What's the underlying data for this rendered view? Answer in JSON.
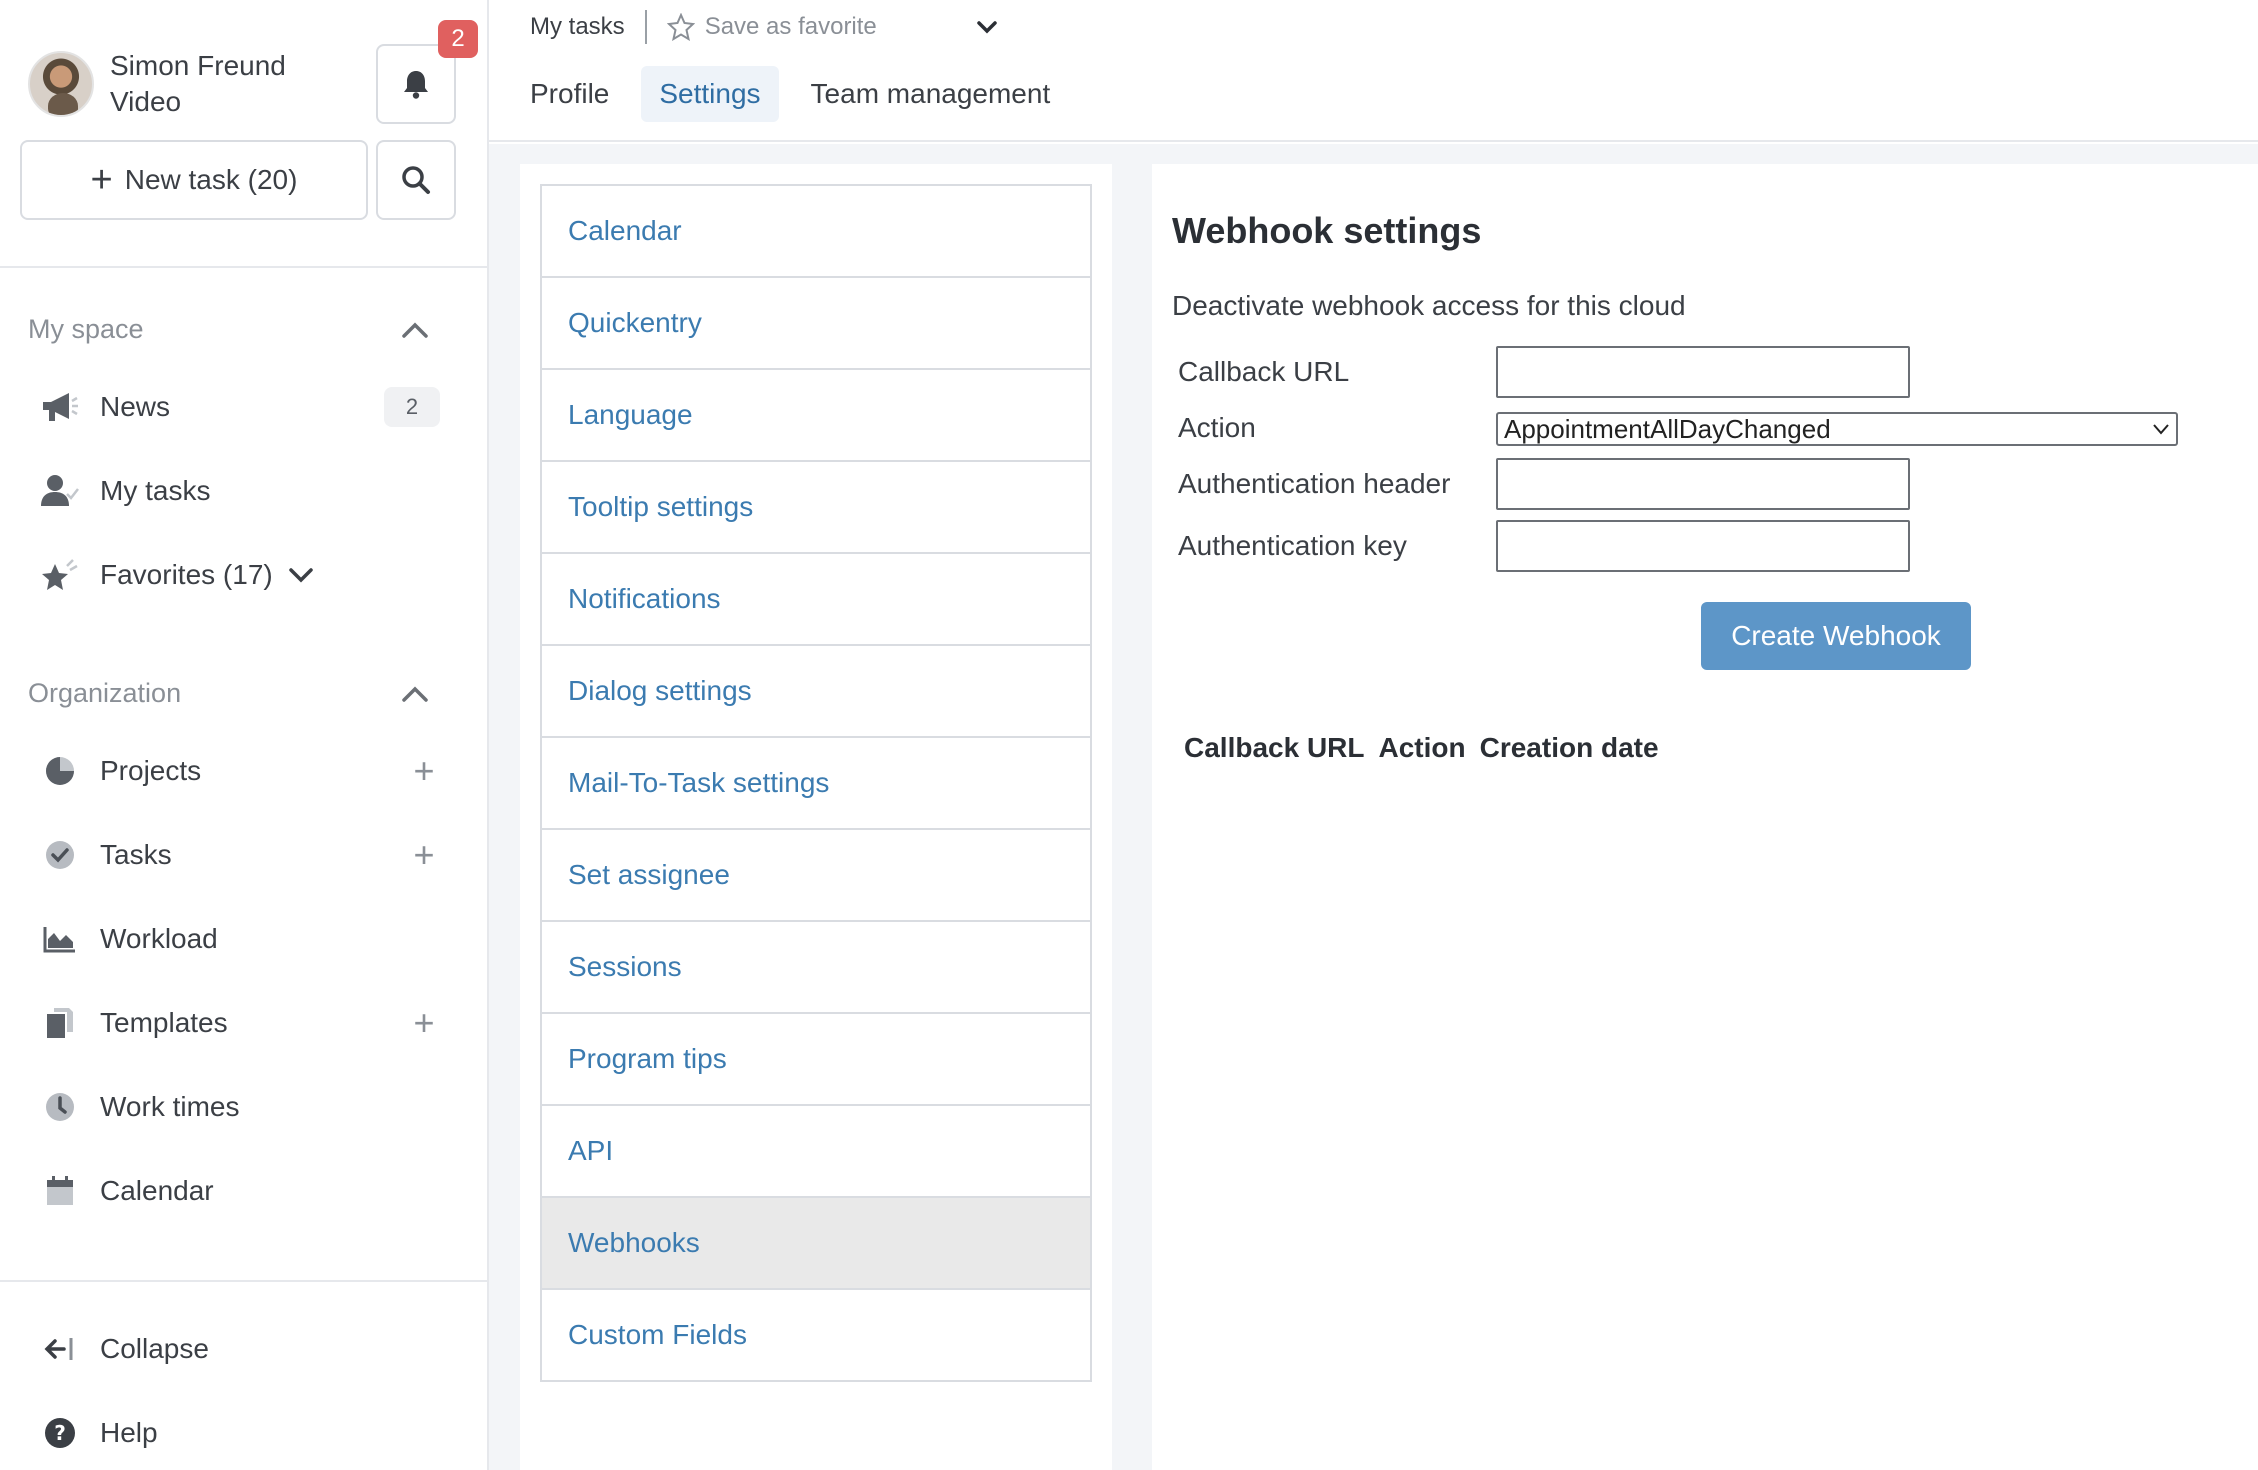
{
  "user": {
    "name": "Simon Freund",
    "subtitle": "Video"
  },
  "notifications": {
    "count": "2"
  },
  "new_task": {
    "label": "New task (20)"
  },
  "my_space": {
    "title": "My space",
    "items": [
      {
        "label": "News",
        "count": "2",
        "icon": "megaphone-icon"
      },
      {
        "label": "My tasks",
        "icon": "user-check-icon"
      },
      {
        "label": "Favorites (17)",
        "icon": "star-icon"
      }
    ]
  },
  "organization": {
    "title": "Organization",
    "items": [
      {
        "label": "Projects",
        "icon": "pie-icon",
        "add": "+"
      },
      {
        "label": "Tasks",
        "icon": "check-circle-icon",
        "add": "+"
      },
      {
        "label": "Workload",
        "icon": "area-chart-icon"
      },
      {
        "label": "Templates",
        "icon": "documents-icon",
        "add": "+"
      },
      {
        "label": "Work times",
        "icon": "clock-icon"
      },
      {
        "label": "Calendar",
        "icon": "calendar-icon"
      }
    ]
  },
  "footer": {
    "collapse": "Collapse",
    "help": "Help"
  },
  "breadcrumb": {
    "current": "My tasks",
    "favorite": "Save as favorite"
  },
  "tabs": [
    {
      "label": "Profile"
    },
    {
      "label": "Settings",
      "active": true
    },
    {
      "label": "Team management"
    }
  ],
  "settings_menu": [
    "Calendar",
    "Quickentry",
    "Language",
    "Tooltip settings",
    "Notifications",
    "Dialog settings",
    "Mail-To-Task settings",
    "Set assignee",
    "Sessions",
    "Program tips",
    "API",
    "Webhooks",
    "Custom Fields"
  ],
  "webhook": {
    "title": "Webhook settings",
    "description": "Deactivate webhook access for this cloud",
    "callback_label": "Callback URL",
    "callback_value": "",
    "action_label": "Action",
    "action_value": "AppointmentAllDayChanged",
    "auth_header_label": "Authentication header",
    "auth_header_value": "",
    "auth_key_label": "Authentication key",
    "auth_key_value": "",
    "create_button": "Create Webhook",
    "table_headers": [
      "Callback URL",
      "Action",
      "Creation date"
    ]
  },
  "colors": {
    "accent": "#3b7bb0",
    "button": "#5d96c8",
    "badge": "#e0605f",
    "active_menu": "#e9e9e9"
  }
}
